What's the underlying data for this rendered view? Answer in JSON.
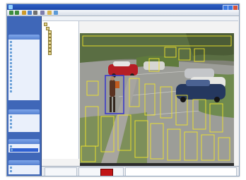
{
  "window": {
    "title": "",
    "colors": {
      "titlebar": "#2457be",
      "sidebar": "#3f67b8",
      "accent_red": "#c21515",
      "detection_box": "#f1e52a",
      "selected_box": "#3a3ac8"
    }
  },
  "toolbar": {
    "buttons": [
      {
        "icon": "back-icon"
      },
      {
        "icon": "forward-icon"
      },
      {
        "icon": "home-icon"
      },
      {
        "icon": "refresh-icon"
      },
      {
        "icon": "search-icon"
      },
      {
        "icon": "settings-icon"
      },
      {
        "icon": "folder-icon"
      },
      {
        "icon": "help-icon"
      }
    ]
  },
  "sidebar": {
    "sections": [
      {
        "title": "",
        "items": [
          "",
          "",
          "",
          "",
          "",
          "",
          "",
          "",
          "",
          "",
          "",
          "",
          "",
          "",
          ""
        ]
      },
      {
        "title": "",
        "items": [
          "",
          "",
          "",
          ""
        ]
      },
      {
        "title": "",
        "items": [
          "",
          ""
        ]
      },
      {
        "title": "",
        "items": [
          "",
          ""
        ]
      }
    ]
  },
  "tree": {
    "nodes": [
      "",
      "",
      "",
      "",
      "",
      "",
      "",
      "",
      ""
    ]
  },
  "video": {
    "detection_zones": 22,
    "selected_object": "person"
  },
  "bottom": {
    "left_labels": [
      "",
      "",
      ""
    ],
    "mid_labels": [
      "",
      "",
      ""
    ],
    "log_lines": [
      "",
      "",
      "",
      "",
      "",
      "",
      "",
      ""
    ]
  }
}
